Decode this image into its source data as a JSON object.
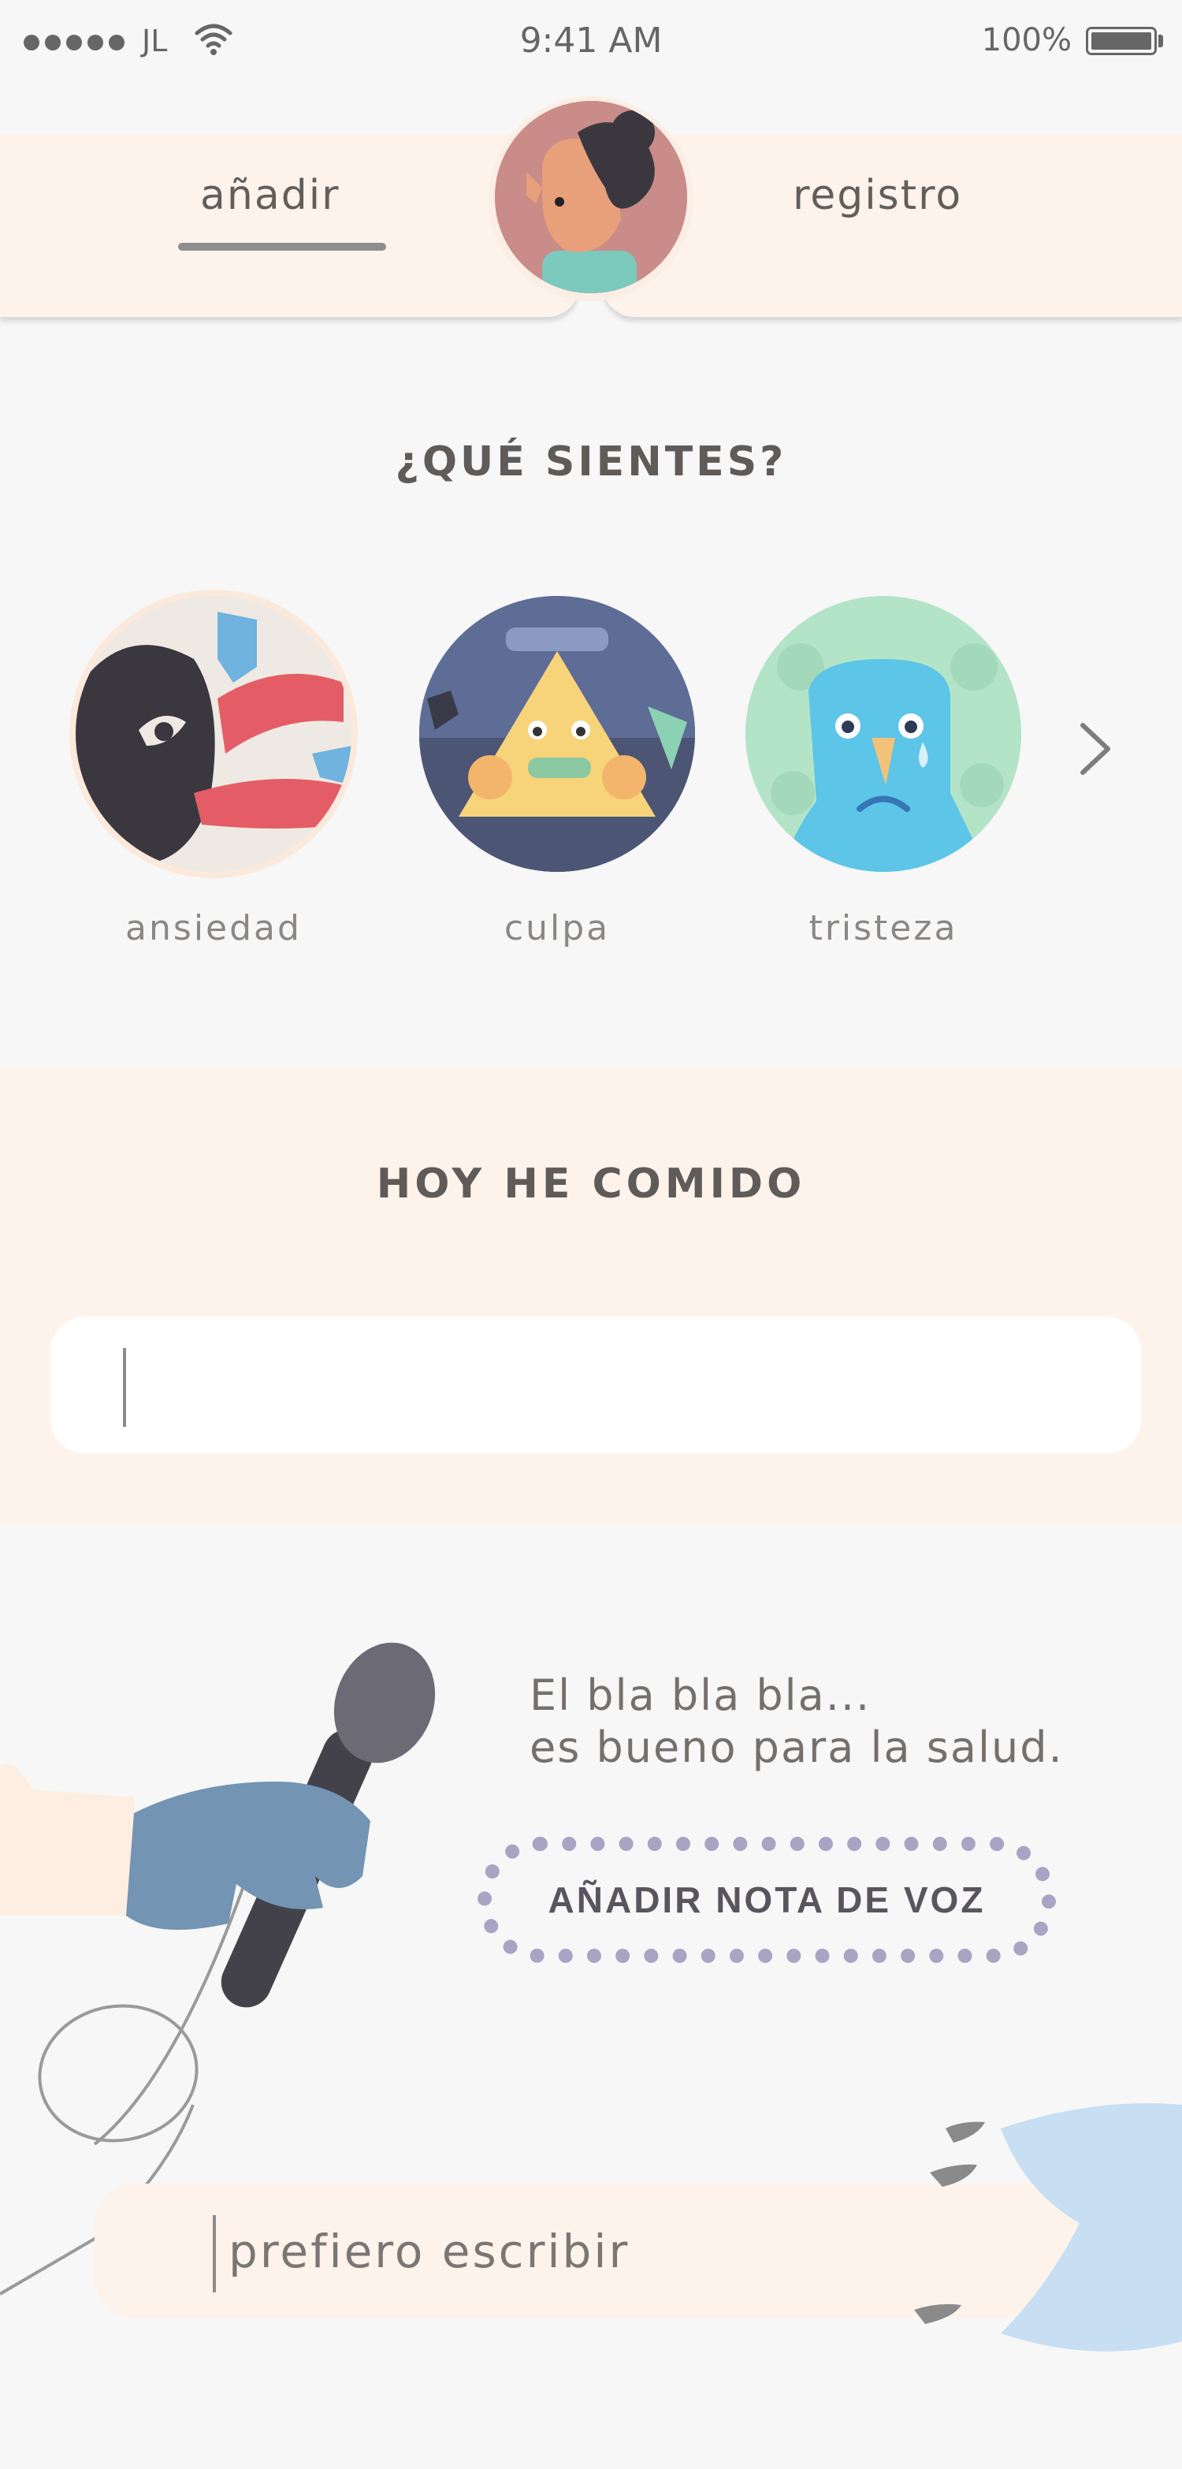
{
  "status_bar": {
    "carrier": "JL",
    "time": "9:41 AM",
    "battery": "100%"
  },
  "tabs": {
    "add_label": "añadir",
    "log_label": "registro"
  },
  "question": "¿QUÉ SIENTES?",
  "emotions": [
    {
      "label": "ansiedad"
    },
    {
      "label": "culpa"
    },
    {
      "label": "tristeza"
    }
  ],
  "food": {
    "title": "HOY HE COMIDO",
    "value": ""
  },
  "voice": {
    "text": "El bla bla bla...\nes bueno para la salud.",
    "button_label": "AÑADIR NOTA DE VOZ"
  },
  "write": {
    "label": "prefiero escribir"
  }
}
